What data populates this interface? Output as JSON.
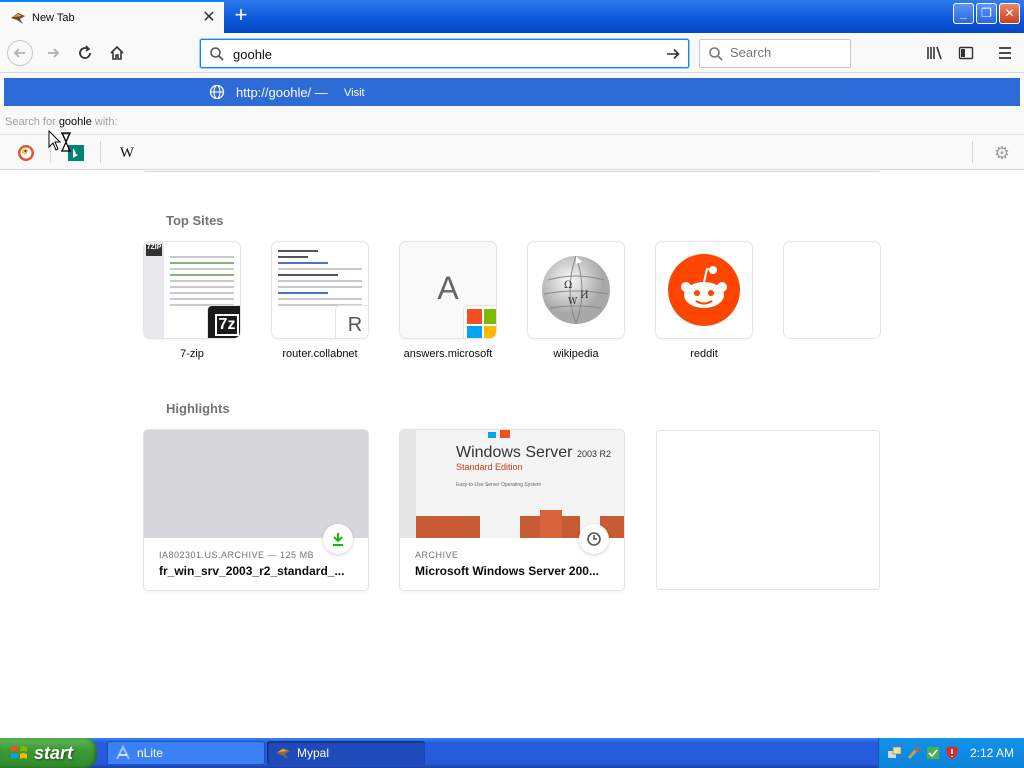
{
  "browser": {
    "tab_title": "New Tab",
    "url_value": "goohle",
    "search_placeholder": "Search"
  },
  "popup": {
    "suggestion_url": "http://goohle/",
    "suggestion_sep": " — ",
    "suggestion_action": "Visit",
    "search_for_prefix": "Search for ",
    "search_for_query": "goohle",
    "search_for_suffix": " with:",
    "engines": [
      "DuckDuckGo",
      "Bing",
      "Wikipedia"
    ]
  },
  "newtab": {
    "top_sites_title": "Top Sites",
    "top_sites": [
      {
        "label": "7-zip",
        "icon": "7z-icon"
      },
      {
        "label": "router.collabnet",
        "icon": "R"
      },
      {
        "label": "answers.microsoft",
        "icon": "A"
      },
      {
        "label": "wikipedia",
        "icon": "wikipedia-globe-icon"
      },
      {
        "label": "reddit",
        "icon": "reddit-icon"
      },
      {
        "label": "",
        "icon": ""
      }
    ],
    "highlights_title": "Highlights",
    "highlights": [
      {
        "context": "IA802301.US.ARCHIVE — 125 MB",
        "title": "fr_win_srv_2003_r2_standard_..."
      },
      {
        "context": "ARCHIVE",
        "title": "Microsoft Windows Server 200..."
      }
    ],
    "box_text": {
      "windows": "Windows Server",
      "year": "2003 R2",
      "edition": "Standard Edition",
      "tagline": "Easy-to-Use Server Operating System"
    }
  },
  "taskbar": {
    "start_label": "start",
    "tasks": [
      {
        "label": "nLite"
      },
      {
        "label": "Mypal"
      }
    ],
    "clock": "2:12 AM"
  },
  "colors": {
    "accent": "#0a84ff",
    "suggestion_bg": "#2d6bd6",
    "reddit": "#ff4500",
    "taskbar": "#245edb",
    "start": "#3c9a36"
  }
}
